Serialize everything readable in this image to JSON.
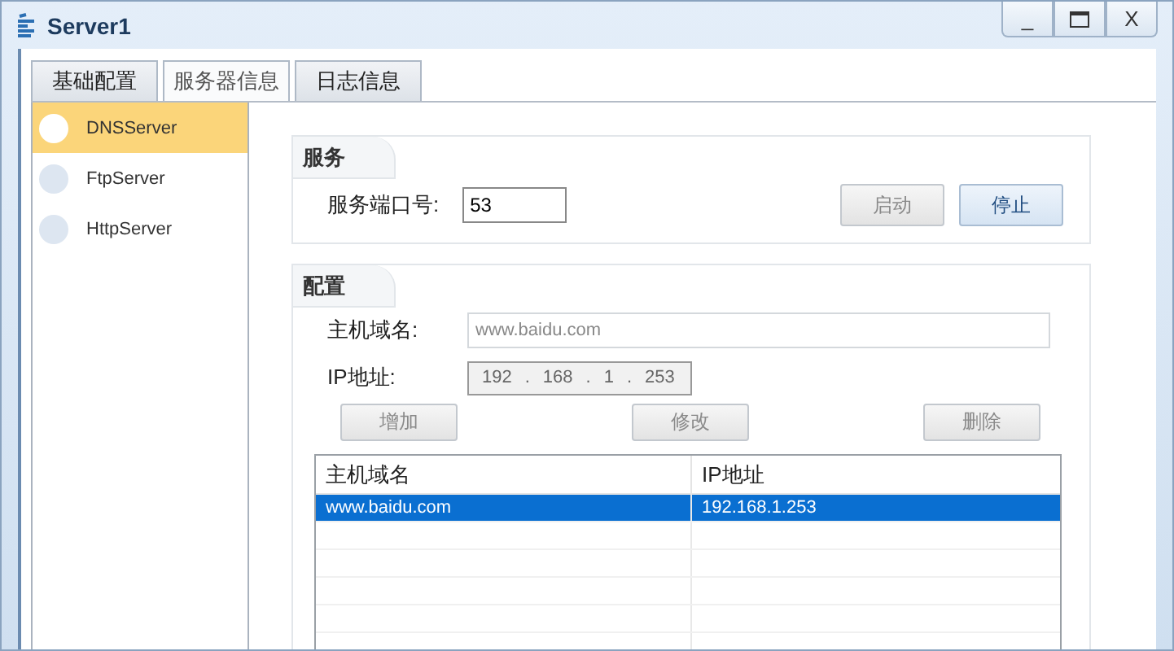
{
  "window": {
    "title": "Server1",
    "controls": [
      "_",
      "X"
    ]
  },
  "tabs": [
    {
      "label": "基础配置",
      "selected": false
    },
    {
      "label": "服务器信息",
      "selected": true
    },
    {
      "label": "日志信息",
      "selected": false
    }
  ],
  "sidebar": {
    "items": [
      {
        "label": "DNSServer",
        "selected": true
      },
      {
        "label": "FtpServer",
        "selected": false
      },
      {
        "label": "HttpServer",
        "selected": false
      }
    ]
  },
  "service": {
    "title": "服务",
    "port_label": "服务端口号:",
    "port_value": "53",
    "buttons": [
      {
        "label": "启动",
        "disabled": true
      },
      {
        "label": "停止",
        "disabled": false
      }
    ]
  },
  "config": {
    "title": "配置",
    "host_label": "主机域名:",
    "host_placeholder": "www.baidu.com",
    "ip_label": "IP地址:",
    "ip_parts": [
      "192",
      "168",
      "1",
      "253"
    ],
    "ip_separator": ".",
    "buttons": [
      {
        "label": "增加",
        "disabled": true
      },
      {
        "label": "修改",
        "disabled": true
      },
      {
        "label": "删除",
        "disabled": true
      }
    ]
  },
  "table": {
    "columns": [
      "主机域名",
      "IP地址"
    ],
    "rows": [
      {
        "cells": [
          "www.baidu.com",
          "192.168.1.253"
        ],
        "selected": true
      }
    ]
  }
}
